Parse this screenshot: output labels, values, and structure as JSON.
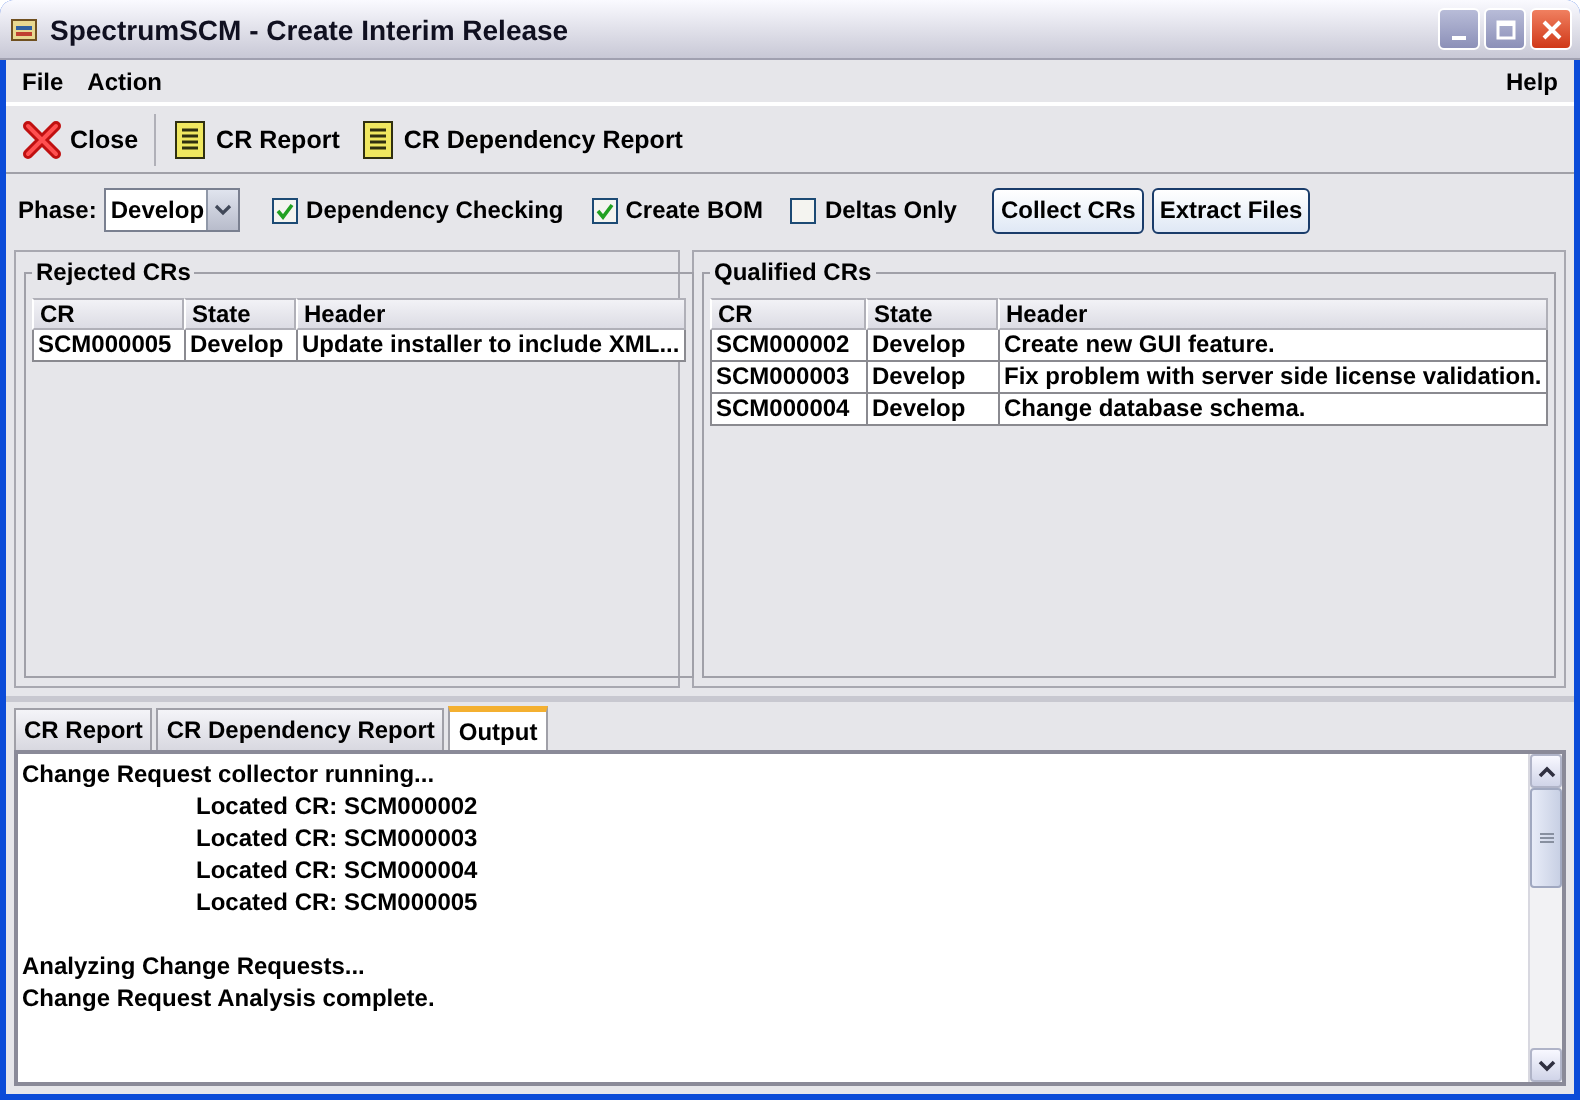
{
  "window": {
    "title": "SpectrumSCM - Create Interim Release"
  },
  "menu": {
    "left": [
      "File",
      "Action"
    ],
    "right": [
      "Help"
    ]
  },
  "toolbar": [
    {
      "kind": "close",
      "label": "Close"
    },
    {
      "kind": "report",
      "label": "CR Report"
    },
    {
      "kind": "report",
      "label": "CR Dependency Report"
    }
  ],
  "options": {
    "phase_label": "Phase:",
    "phase_value": "Develop",
    "checkboxes": [
      {
        "label": "Dependency Checking",
        "checked": true
      },
      {
        "label": "Create BOM",
        "checked": true
      },
      {
        "label": "Deltas Only",
        "checked": false
      }
    ],
    "buttons": [
      "Collect CRs",
      "Extract Files"
    ]
  },
  "panels": [
    {
      "title": "Rejected CRs",
      "columns": [
        "CR",
        "State",
        "Header"
      ],
      "rows": [
        [
          "SCM000005",
          "Develop",
          "Update installer to include XML..."
        ]
      ]
    },
    {
      "title": "Qualified CRs",
      "columns": [
        "CR",
        "State",
        "Header"
      ],
      "rows": [
        [
          "SCM000002",
          "Develop",
          "Create new GUI feature."
        ],
        [
          "SCM000003",
          "Develop",
          "Fix problem with server side license validation."
        ],
        [
          "SCM000004",
          "Develop",
          "Change database schema."
        ]
      ]
    }
  ],
  "tabs": [
    {
      "label": "CR Report",
      "selected": false
    },
    {
      "label": "CR Dependency Report",
      "selected": false
    },
    {
      "label": "Output",
      "selected": true
    }
  ],
  "output": [
    {
      "kind": "line",
      "text": "Change Request collector running..."
    },
    {
      "kind": "indent",
      "text": "Located CR: SCM000002"
    },
    {
      "kind": "indent",
      "text": "Located CR: SCM000003"
    },
    {
      "kind": "indent",
      "text": "Located CR: SCM000004"
    },
    {
      "kind": "indent",
      "text": "Located CR: SCM000005"
    },
    {
      "kind": "blank"
    },
    {
      "kind": "line",
      "text": "Analyzing Change Requests..."
    },
    {
      "kind": "line",
      "text": "Change Request Analysis complete."
    }
  ]
}
